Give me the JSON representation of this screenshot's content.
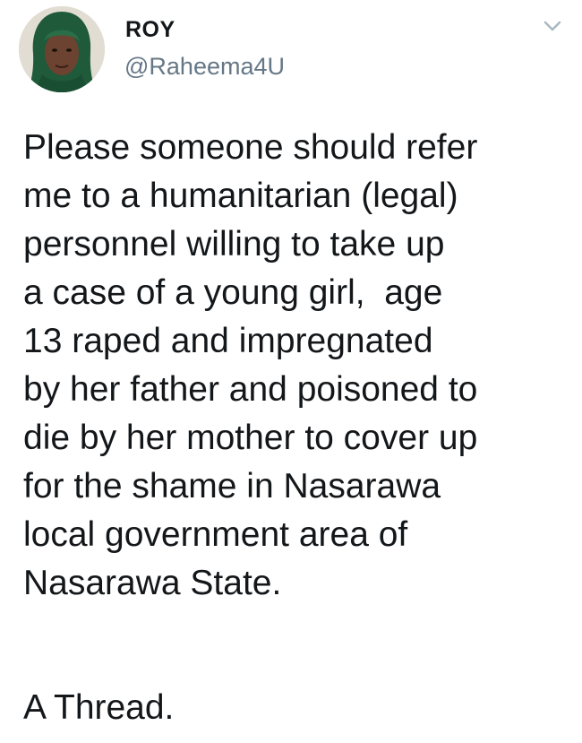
{
  "tweet": {
    "author": {
      "display_name": "ROY",
      "handle": "@Raheema4U"
    },
    "icons": {
      "avatar": "profile-photo",
      "menu": "chevron-down-icon"
    },
    "text_lines": [
      "Please someone should refer",
      "me to a humanitarian (legal)",
      "personnel willing to take up",
      "a case of a young girl,  age",
      "13 raped and impregnated",
      "by her father and poisoned to",
      "die by her mother to cover up",
      "for the shame in Nasarawa",
      "local government area of",
      "Nasarawa State."
    ],
    "thread_label": "A Thread.",
    "colors": {
      "text": "#14171a",
      "secondary": "#657786",
      "caret": "#aab8c2"
    }
  }
}
